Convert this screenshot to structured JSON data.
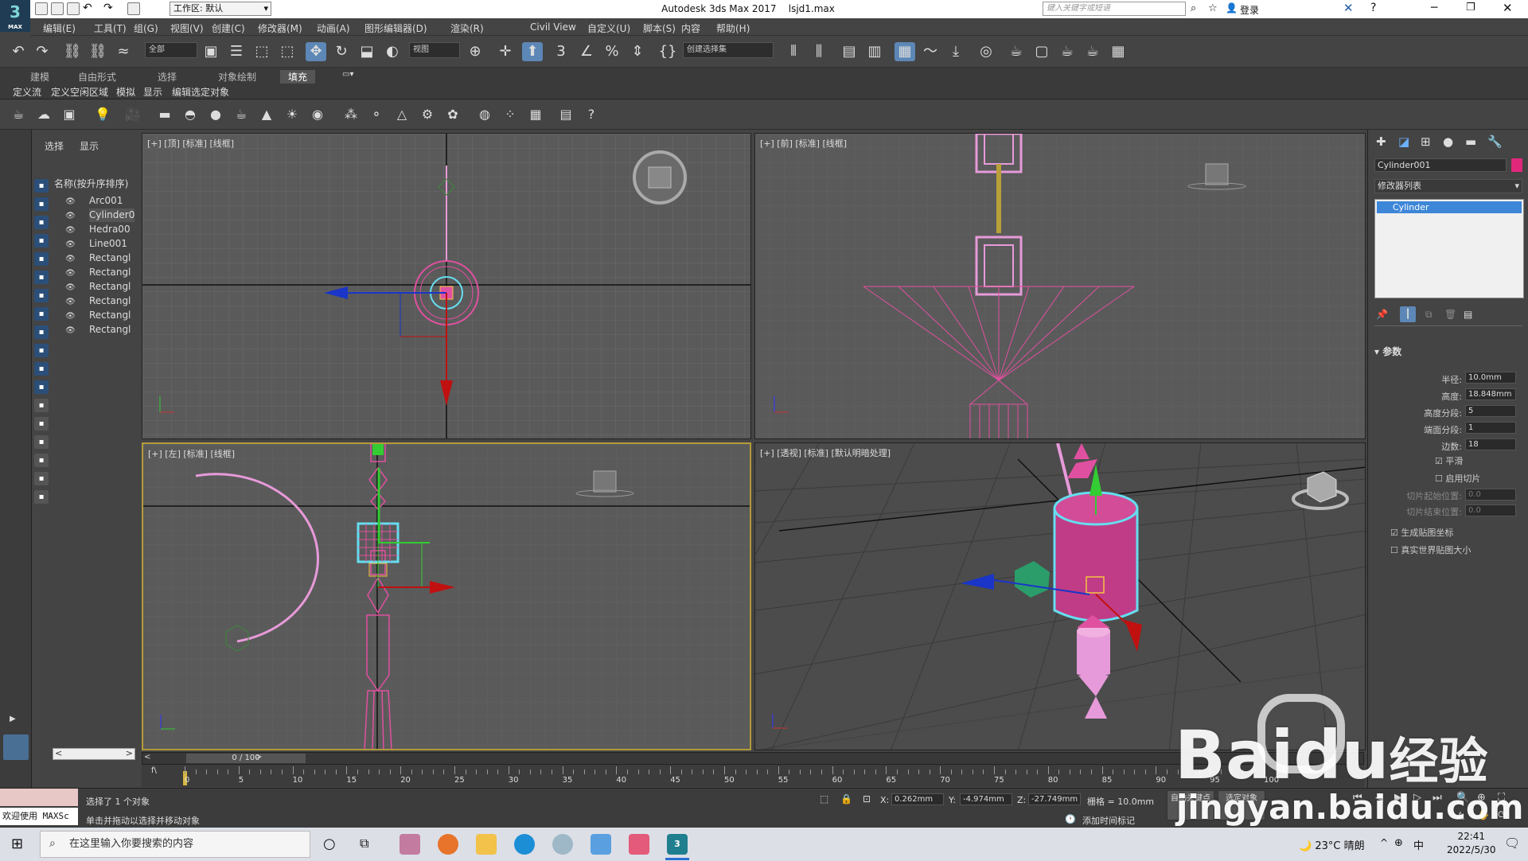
{
  "app": {
    "logo_text": "3",
    "logo_sub": "MAX",
    "workspace": "工作区: 默认",
    "title": "Autodesk 3ds Max 2017",
    "file": "lsjd1.max",
    "search_placeholder": "键入关键字或短语",
    "login": "登录"
  },
  "menus": [
    "编辑(E)",
    "工具(T)",
    "组(G)",
    "视图(V)",
    "创建(C)",
    "修改器(M)",
    "动画(A)",
    "图形编辑器(D)",
    "渲染(R)",
    "Civil View",
    "自定义(U)",
    "脚本(S)",
    "内容",
    "帮助(H)"
  ],
  "toolbar": {
    "filter": "全部",
    "refcoord": "视图",
    "selset": "创建选择集"
  },
  "ribbon": {
    "tabs": [
      "建模",
      "自由形式",
      "选择",
      "对象绘制",
      "填充"
    ],
    "active_tab": "填充",
    "sub": [
      "定义流",
      "定义空闲区域",
      "模拟",
      "显示",
      "编辑选定对象"
    ]
  },
  "scene": {
    "tabs": [
      "选择",
      "显示"
    ],
    "header": "名称(按升序排序)",
    "items": [
      "Arc001",
      "Cylinder0",
      "Hedra00",
      "Line001",
      "Rectangl",
      "Rectangl",
      "Rectangl",
      "Rectangl",
      "Rectangl",
      "Rectangl"
    ],
    "selected_index": 1
  },
  "viewports": {
    "top": "[+] [顶] [标准] [线框]",
    "front": "[+] [前] [标准] [线框]",
    "left": "[+] [左] [标准] [线框]",
    "persp": "[+] [透视] [标准] [默认明暗处理]"
  },
  "command": {
    "object_name": "Cylinder001",
    "object_color": "#e0287a",
    "modifier_list": "修改器列表",
    "stack_item": "Cylinder",
    "rollout": "参数",
    "params": [
      {
        "label": "半径:",
        "value": "10.0mm"
      },
      {
        "label": "高度:",
        "value": "18.848mm"
      },
      {
        "label": "高度分段:",
        "value": "5"
      },
      {
        "label": "端面分段:",
        "value": "1"
      },
      {
        "label": "边数:",
        "value": "18"
      }
    ],
    "smooth": "平滑",
    "slice_on": "启用切片",
    "slice_from": "切片起始位置:",
    "slice_from_val": "0.0",
    "slice_to": "切片结束位置:",
    "slice_to_val": "0.0",
    "gen_map": "生成贴图坐标",
    "real_world": "真实世界贴图大小"
  },
  "timeline": {
    "frame": "0 / 100",
    "ticks": [
      "0",
      "5",
      "10",
      "15",
      "20",
      "25",
      "30",
      "35",
      "40",
      "45",
      "50",
      "55",
      "60",
      "65",
      "70",
      "75",
      "80",
      "85",
      "90",
      "95",
      "100"
    ]
  },
  "status": {
    "welcome": "欢迎使用 MAXSc",
    "selected": "选择了 1 个对象",
    "hint": "单击并拖动以选择并移动对象",
    "x_label": "X:",
    "x": "0.262mm",
    "y_label": "Y:",
    "y": "-4.974mm",
    "z_label": "Z:",
    "z": "-27.749mm",
    "grid": "栅格 = 10.0mm",
    "add_time_tag": "添加时间标记",
    "auto_key": "自动关键点",
    "set_key": "选定对象"
  },
  "taskbar": {
    "search": "在这里输入你要搜索的内容",
    "temp": "23°C",
    "weather": "晴朗",
    "ime": "中",
    "time": "22:41",
    "date": "2022/5/30"
  },
  "watermark": {
    "brand": "Bai",
    "brand2": "du",
    "brand3": "经验",
    "url": "jingyan.baidu.com"
  }
}
